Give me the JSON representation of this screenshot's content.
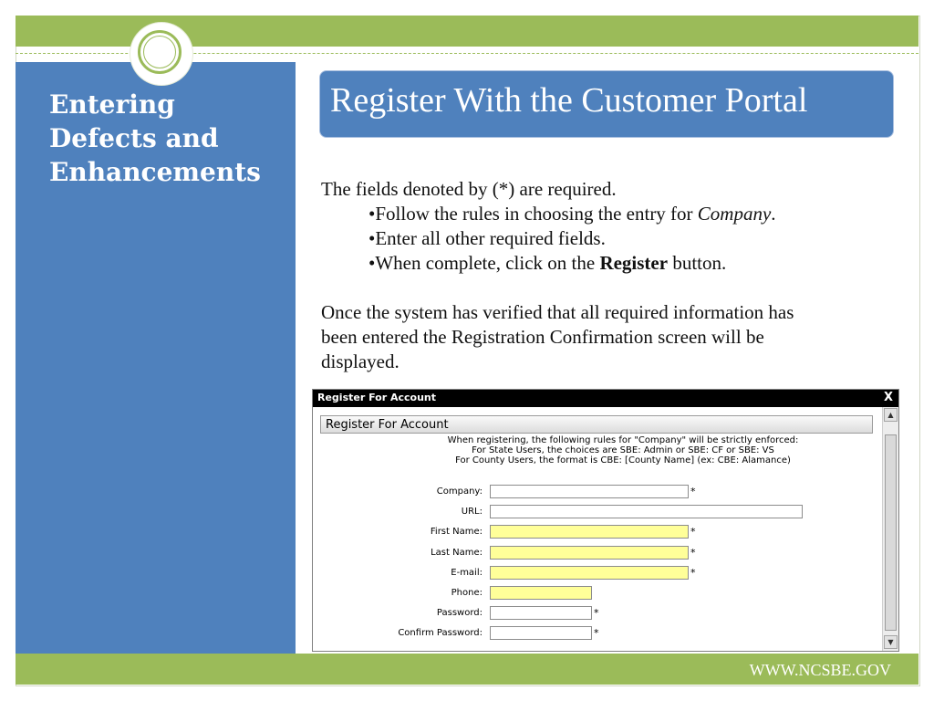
{
  "sidebar": {
    "title_line1": "Entering",
    "title_line2": "Defects and",
    "title_line3": "Enhancements"
  },
  "slide": {
    "title": "Register With the Customer Portal",
    "intro": "The fields denoted by (*) are required.",
    "bullet1_prefix": "•Follow the rules in choosing the entry for ",
    "bullet1_em": "Company",
    "bullet1_suffix": ".",
    "bullet2": "•Enter all other required fields.",
    "bullet3_prefix": "•When complete, click on the ",
    "bullet3_bold": "Register",
    "bullet3_suffix": " button.",
    "para2_line1": "Once the system has verified that all required information has",
    "para2_line2": "been entered the Registration Confirmation screen will be",
    "para2_line3": "displayed."
  },
  "dialog": {
    "window_title": "Register For Account",
    "close": "X",
    "header": "Register For Account",
    "rule1": "When registering, the following rules for \"Company\" will be strictly enforced:",
    "rule2": "For State Users, the choices are SBE: Admin or SBE: CF or SBE: VS",
    "rule3": "For County Users, the format is CBE: [County Name] (ex: CBE: Alamance)",
    "scroll_up": "▲",
    "scroll_down": "▼",
    "fields": {
      "company": {
        "label": "Company:",
        "value": "",
        "required_mark": "*"
      },
      "url": {
        "label": "URL:",
        "value": ""
      },
      "first_name": {
        "label": "First Name:",
        "value": "",
        "required_mark": "*"
      },
      "last_name": {
        "label": "Last Name:",
        "value": "",
        "required_mark": "*"
      },
      "email": {
        "label": "E-mail:",
        "value": "",
        "required_mark": "*"
      },
      "phone": {
        "label": "Phone:",
        "value": ""
      },
      "password": {
        "label": "Password:",
        "value": "",
        "required_mark": "*"
      },
      "confirm_password": {
        "label": "Confirm Password:",
        "value": "",
        "required_mark": "*"
      }
    }
  },
  "footer": {
    "link": "WWW.NCSBE.GOV"
  },
  "colors": {
    "accent_green": "#9bbb59",
    "accent_blue": "#4f81bd",
    "required_field": "#ffff99"
  }
}
